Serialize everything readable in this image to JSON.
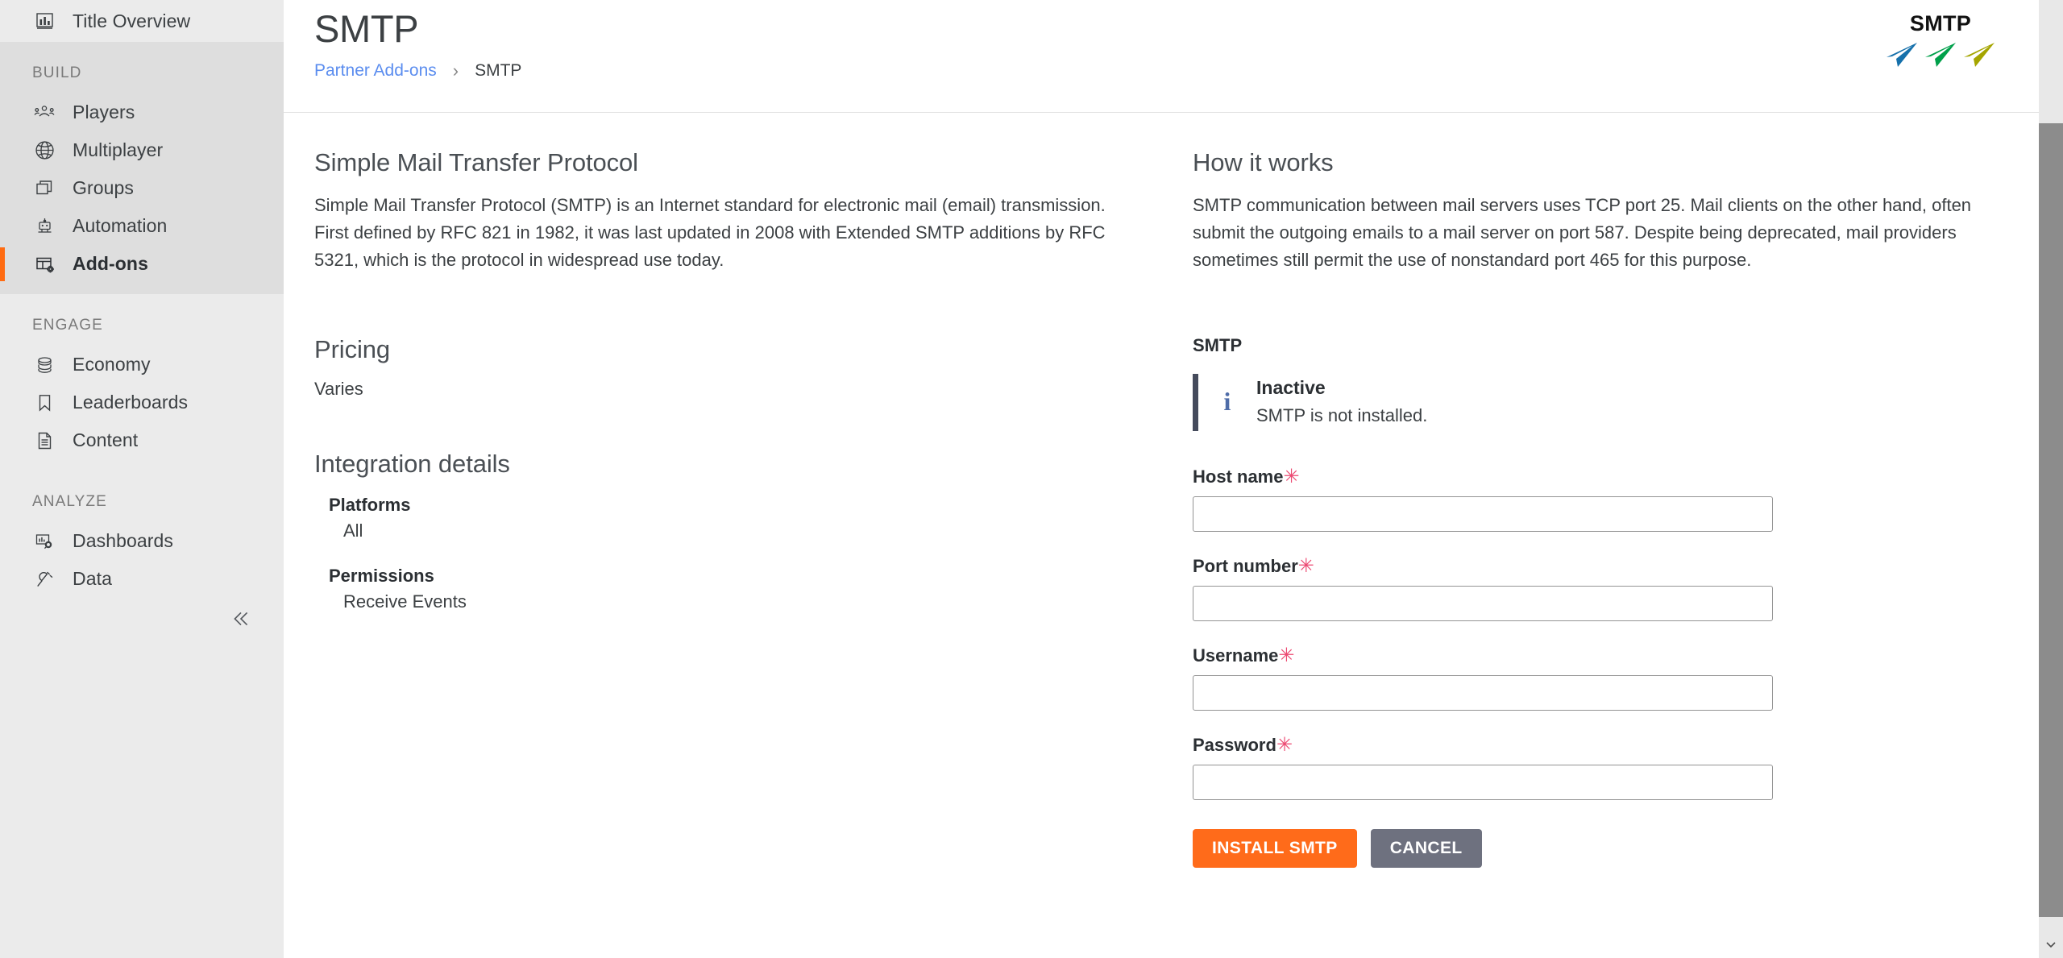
{
  "sidebar": {
    "top_item": {
      "label": "Title Overview",
      "icon": "bar-chart-icon"
    },
    "groups": [
      {
        "title": "BUILD",
        "items": [
          {
            "label": "Players",
            "icon": "players-icon",
            "active": false
          },
          {
            "label": "Multiplayer",
            "icon": "globe-icon",
            "active": false
          },
          {
            "label": "Groups",
            "icon": "groups-stack-icon",
            "active": false
          },
          {
            "label": "Automation",
            "icon": "robot-icon",
            "active": false
          },
          {
            "label": "Add-ons",
            "icon": "addons-grid-icon",
            "active": true
          }
        ]
      },
      {
        "title": "ENGAGE",
        "items": [
          {
            "label": "Economy",
            "icon": "coins-stack-icon",
            "active": false
          },
          {
            "label": "Leaderboards",
            "icon": "bookmark-icon",
            "active": false
          },
          {
            "label": "Content",
            "icon": "document-icon",
            "active": false
          }
        ]
      },
      {
        "title": "ANALYZE",
        "items": [
          {
            "label": "Dashboards",
            "icon": "dashboard-search-icon",
            "active": false
          },
          {
            "label": "Data",
            "icon": "plug-icon",
            "active": false
          }
        ]
      }
    ],
    "collapse_icon": "double-chevron-left-icon"
  },
  "header": {
    "title": "SMTP",
    "breadcrumb": {
      "parent": "Partner Add-ons",
      "separator": "›",
      "current": "SMTP"
    },
    "logo": {
      "wordmark": "SMTP",
      "plane_colors": [
        "#1570ab",
        "#00a04a",
        "#a5a500"
      ]
    }
  },
  "left_column": {
    "overview": {
      "heading": "Simple Mail Transfer Protocol",
      "body": "Simple Mail Transfer Protocol (SMTP) is an Internet standard for electronic mail (email) transmission. First defined by RFC 821 in 1982, it was last updated in 2008 with Extended SMTP additions by RFC 5321, which is the protocol in widespread use today."
    },
    "pricing": {
      "heading": "Pricing",
      "value": "Varies"
    },
    "integration": {
      "heading": "Integration details",
      "details": [
        {
          "key": "Platforms",
          "value": "All"
        },
        {
          "key": "Permissions",
          "value": "Receive Events"
        }
      ]
    }
  },
  "right_column": {
    "how_it_works": {
      "heading": "How it works",
      "body": "SMTP communication between mail servers uses TCP port 25. Mail clients on the other hand, often submit the outgoing emails to a mail server on port 587. Despite being deprecated, mail providers sometimes still permit the use of nonstandard port 465 for this purpose."
    },
    "form": {
      "section_title": "SMTP",
      "status": {
        "icon": "info-icon",
        "title": "Inactive",
        "description": "SMTP is not installed.",
        "accent_color": "#454b5c"
      },
      "fields": [
        {
          "label": "Host name",
          "required_mark": "✳",
          "value": "",
          "placeholder": "",
          "type": "text"
        },
        {
          "label": "Port number",
          "required_mark": "✳",
          "value": "",
          "placeholder": "",
          "type": "text"
        },
        {
          "label": "Username",
          "required_mark": "✳",
          "value": "",
          "placeholder": "",
          "type": "text"
        },
        {
          "label": "Password",
          "required_mark": "✳",
          "value": "",
          "placeholder": "",
          "type": "password"
        }
      ],
      "buttons": {
        "install": {
          "label": "INSTALL SMTP",
          "color": "#ff6b1a"
        },
        "cancel": {
          "label": "CANCEL",
          "color": "#6e717f"
        }
      }
    }
  },
  "scrollbar": {
    "up_icon": "chevron-up-icon",
    "down_icon": "chevron-down-icon"
  },
  "colors": {
    "accent_orange": "#ff6b1a",
    "link_blue": "#5b8def",
    "required_pink": "#ec4a72",
    "sidebar_bg": "#ebebeb",
    "sidebar_group_bg": "#dedede"
  }
}
